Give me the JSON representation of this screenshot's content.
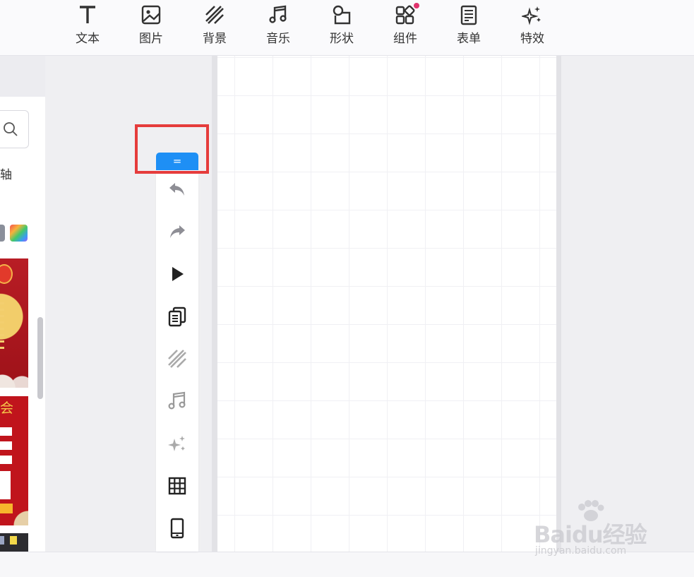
{
  "toolbar": {
    "items": [
      {
        "label": "文本",
        "icon": "text-icon"
      },
      {
        "label": "图片",
        "icon": "image-icon"
      },
      {
        "label": "背景",
        "icon": "background-icon"
      },
      {
        "label": "音乐",
        "icon": "music-icon"
      },
      {
        "label": "形状",
        "icon": "shape-icon"
      },
      {
        "label": "组件",
        "icon": "component-icon",
        "badge": true
      },
      {
        "label": "表单",
        "icon": "form-icon"
      },
      {
        "label": "特效",
        "icon": "effects-icon"
      }
    ],
    "badge_color": "#e0336d"
  },
  "left_panel": {
    "tab_partial": "轴",
    "template2_title_partial": "会"
  },
  "side_toolbar": {
    "collapse_label": "=",
    "accent": "#1e8ff5",
    "items": [
      "undo-icon",
      "redo-icon",
      "play-icon",
      "copy-pages-icon",
      "background-icon",
      "music-icon",
      "sparkle-icon",
      "grid-icon",
      "phone-icon"
    ]
  },
  "highlight_color": "#e53c3c",
  "watermark": {
    "logo": "Baidu经验",
    "url": "jingyan.baidu.com"
  }
}
